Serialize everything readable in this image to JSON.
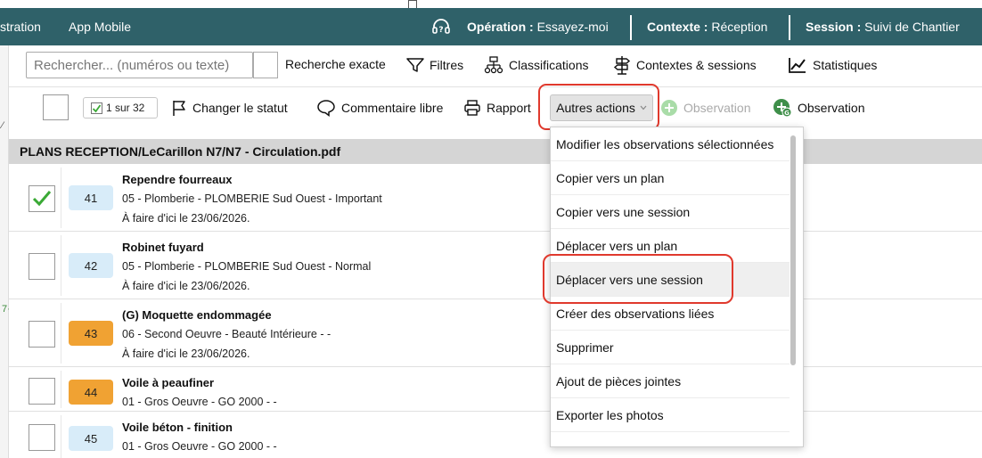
{
  "topbar": {
    "nav_admin": "stration",
    "nav_mobile": "App Mobile",
    "operation_label": "Opération :",
    "operation_value": "Essayez-moi",
    "contexte_label": "Contexte :",
    "contexte_value": "Réception",
    "session_label": "Session :",
    "session_value": "Suivi de Chantier",
    "icon": "headset-question-icon"
  },
  "search": {
    "placeholder": "Rechercher... (numéros ou texte)",
    "exact_label": "Recherche exacte",
    "filters_label": "Filtres",
    "classifications_label": "Classifications",
    "contexts_label": "Contextes & sessions",
    "stats_label": "Statistiques"
  },
  "actions": {
    "count_label": "1 sur 32",
    "change_status_label": "Changer le statut",
    "comment_label": "Commentaire libre",
    "report_label": "Rapport",
    "other_actions_label": "Autres actions",
    "observation_disabled_label": "Observation",
    "observation_label": "Observation"
  },
  "section": {
    "title": "PLANS RECEPTION/LeCarillon N7/N7 - Circulation.pdf"
  },
  "rows": [
    {
      "number": "41",
      "title": "Rependre fourreaux",
      "detail": "05 - Plomberie - PLOMBERIE Sud Ouest - Important",
      "due": "À faire d'ici le 23/06/2026.",
      "checked": true,
      "badge_color": "#d8ecf9"
    },
    {
      "number": "42",
      "title": "Robinet fuyard",
      "detail": "05 - Plomberie - PLOMBERIE Sud Ouest - Normal",
      "due": "À faire d'ici le 23/06/2026.",
      "checked": false,
      "badge_color": "#d8ecf9"
    },
    {
      "number": "43",
      "title": "(G) Moquette endommagée",
      "detail": "06 - Second Oeuvre - Beauté Intérieure - -",
      "due": "À faire d'ici le 23/06/2026.",
      "checked": false,
      "badge_color": "#f0a233"
    },
    {
      "number": "44",
      "title": "Voile à peaufiner",
      "detail": "01 - Gros Oeuvre - GO 2000 - -",
      "due": "",
      "checked": false,
      "badge_color": "#f0a233"
    },
    {
      "number": "45",
      "title": "Voile béton - finition",
      "detail": "01 - Gros Oeuvre - GO 2000 - -",
      "due": "",
      "checked": false,
      "badge_color": "#d8ecf9"
    }
  ],
  "dropdown": {
    "items": [
      "Modifier les observations sélectionnées",
      "Copier vers un plan",
      "Copier vers une session",
      "Déplacer vers un plan",
      "Déplacer vers une session",
      "Créer des observations liées",
      "Supprimer",
      "Ajout de pièces jointes",
      "Exporter les photos"
    ]
  },
  "colors": {
    "topbar": "#2f6169",
    "highlight": "#e0392d",
    "check_green": "#3aa935",
    "add_green": "#3f8f4a",
    "badge_blue": "#d8ecf9",
    "badge_orange": "#f0a233"
  }
}
